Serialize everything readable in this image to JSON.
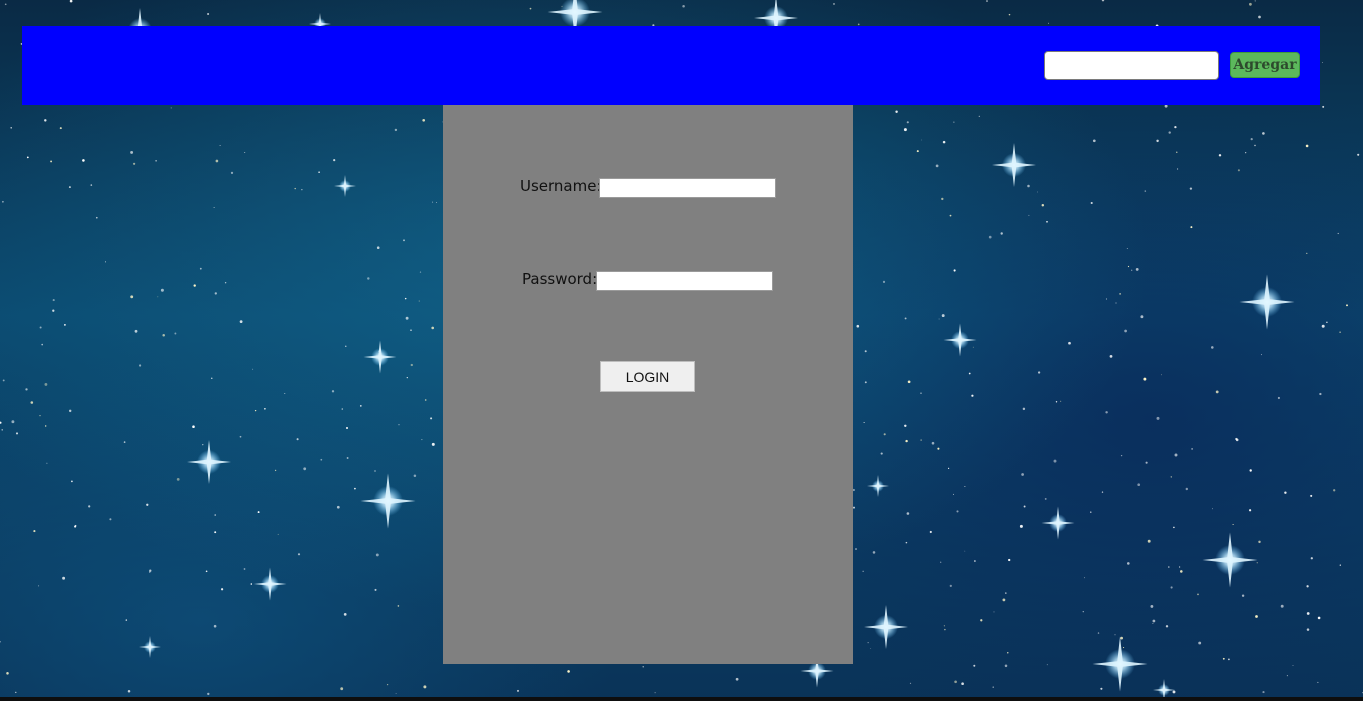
{
  "header": {
    "search_value": "",
    "add_button_label": "Agregar",
    "background_color": "#0000ff"
  },
  "login": {
    "username_label": "Username:",
    "username_value": "",
    "password_label": "Password:",
    "password_value": "",
    "login_button_label": "LOGIN",
    "panel_color": "#808080"
  },
  "background": {
    "description_icon": "starfield-background"
  }
}
